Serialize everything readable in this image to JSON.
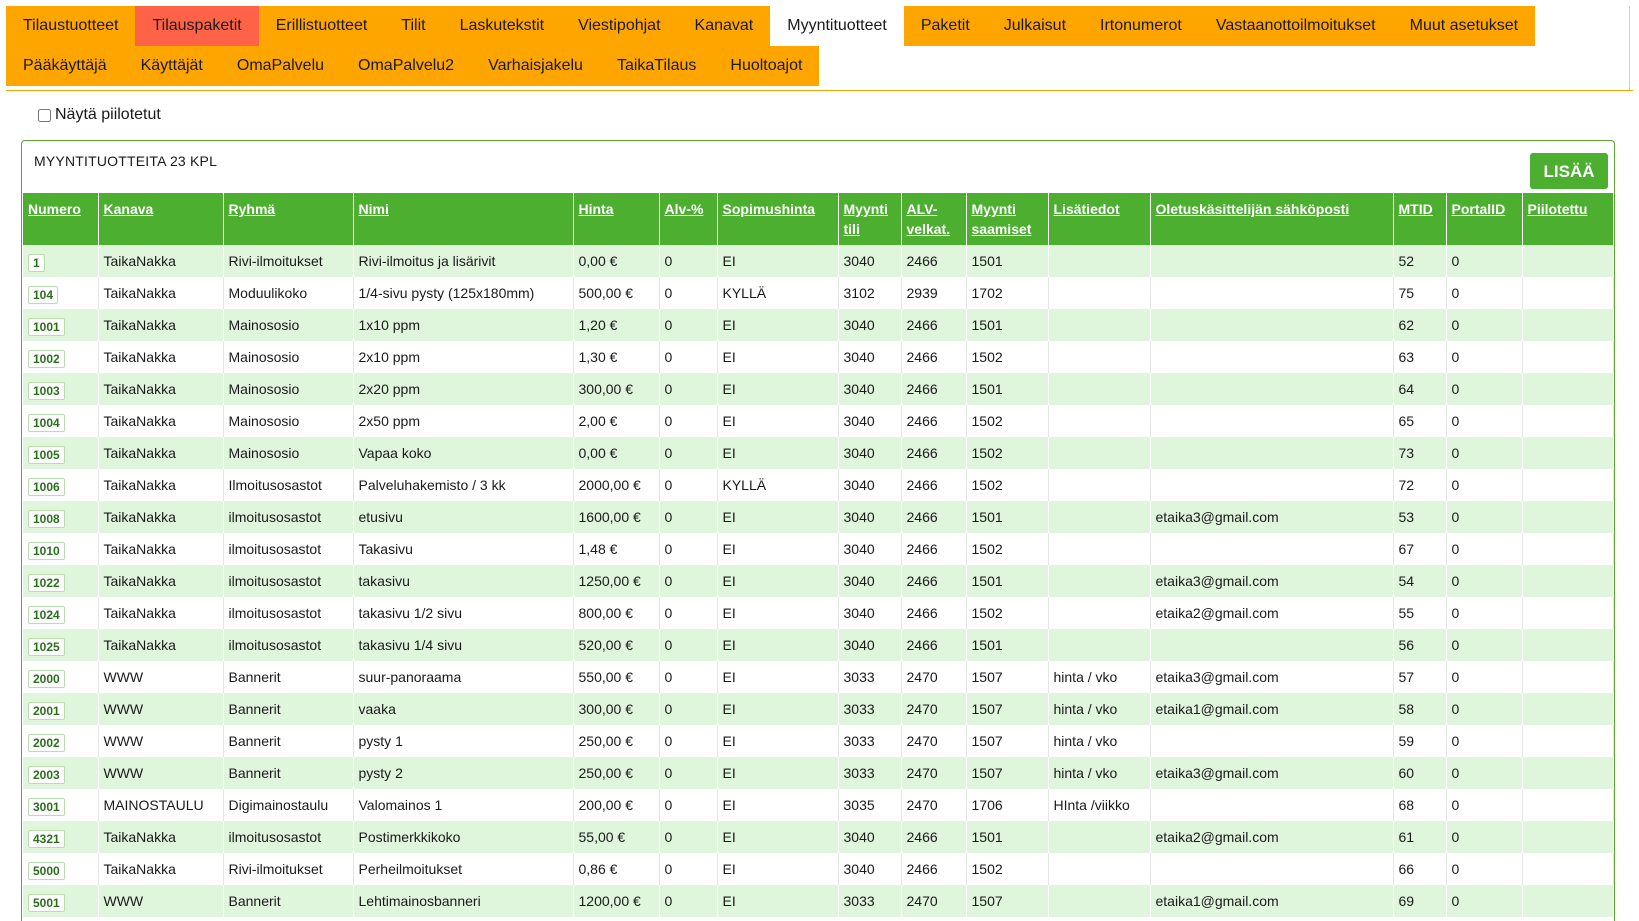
{
  "nav": {
    "row1": [
      {
        "label": "Tilaustuotteet",
        "state": "normal"
      },
      {
        "label": "Tilauspaketit",
        "state": "red"
      },
      {
        "label": "Erillistuotteet",
        "state": "normal"
      },
      {
        "label": "Tilit",
        "state": "normal"
      },
      {
        "label": "Laskutekstit",
        "state": "normal"
      },
      {
        "label": "Viestipohjat",
        "state": "normal"
      },
      {
        "label": "Kanavat",
        "state": "normal"
      },
      {
        "label": "Myyntituotteet",
        "state": "active"
      },
      {
        "label": "Paketit",
        "state": "normal"
      },
      {
        "label": "Julkaisut",
        "state": "normal"
      },
      {
        "label": "Irtonumerot",
        "state": "normal"
      },
      {
        "label": "Vastaanottoilmoitukset",
        "state": "normal"
      },
      {
        "label": "Muut asetukset",
        "state": "normal"
      }
    ],
    "row2": [
      {
        "label": "Pääkäyttäjä",
        "state": "normal"
      },
      {
        "label": "Käyttäjät",
        "state": "normal"
      },
      {
        "label": "OmaPalvelu",
        "state": "normal"
      },
      {
        "label": "OmaPalvelu2",
        "state": "normal"
      },
      {
        "label": "Varhaisjakelu",
        "state": "normal"
      },
      {
        "label": "TaikaTilaus",
        "state": "normal"
      },
      {
        "label": "Huoltoajot",
        "state": "normal"
      }
    ]
  },
  "filter": {
    "show_hidden_label": "Näytä piilotetut",
    "checked": false
  },
  "panel": {
    "title": "MYYNTITUOTTEITA 23 KPL",
    "add_label": "LISÄÄ"
  },
  "colors": {
    "accent": "#ffa500",
    "tab_red": "#ff6347",
    "header_green": "#4caf30",
    "row_green": "#dff5dc"
  },
  "table": {
    "columns": [
      {
        "key": "numero",
        "label": "Numero"
      },
      {
        "key": "kanava",
        "label": "Kanava"
      },
      {
        "key": "ryhma",
        "label": "Ryhmä"
      },
      {
        "key": "nimi",
        "label": "Nimi"
      },
      {
        "key": "hinta",
        "label": "Hinta"
      },
      {
        "key": "alv",
        "label": "Alv-%"
      },
      {
        "key": "sopimushinta",
        "label": "Sopimushinta"
      },
      {
        "key": "myyntitili",
        "label": "Myynti tili"
      },
      {
        "key": "alvvelkat",
        "label": "ALV-velkat."
      },
      {
        "key": "myyntisaamiset",
        "label": "Myynti saamiset"
      },
      {
        "key": "lisatiedot",
        "label": "Lisätiedot"
      },
      {
        "key": "email",
        "label": "Oletuskäsittelijän sähköposti"
      },
      {
        "key": "mtid",
        "label": "MTID"
      },
      {
        "key": "portalid",
        "label": "PortalID"
      },
      {
        "key": "piilotettu",
        "label": "Piilotettu"
      }
    ],
    "rows": [
      [
        "1",
        "TaikaNakka",
        "Rivi-ilmoitukset",
        "Rivi-ilmoitus ja lisärivit",
        "0,00 €",
        "0",
        "EI",
        "3040",
        "2466",
        "1501",
        "",
        "",
        "52",
        "0",
        ""
      ],
      [
        "104",
        "TaikaNakka",
        "Moduulikoko",
        "1/4-sivu pysty (125x180mm)",
        "500,00 €",
        "0",
        "KYLLÄ",
        "3102",
        "2939",
        "1702",
        "",
        "",
        "75",
        "0",
        ""
      ],
      [
        "1001",
        "TaikaNakka",
        "Mainososio",
        "1x10 ppm",
        "1,20 €",
        "0",
        "EI",
        "3040",
        "2466",
        "1501",
        "",
        "",
        "62",
        "0",
        ""
      ],
      [
        "1002",
        "TaikaNakka",
        "Mainososio",
        "2x10 ppm",
        "1,30 €",
        "0",
        "EI",
        "3040",
        "2466",
        "1502",
        "",
        "",
        "63",
        "0",
        ""
      ],
      [
        "1003",
        "TaikaNakka",
        "Mainososio",
        "2x20 ppm",
        "300,00 €",
        "0",
        "EI",
        "3040",
        "2466",
        "1501",
        "",
        "",
        "64",
        "0",
        ""
      ],
      [
        "1004",
        "TaikaNakka",
        "Mainososio",
        "2x50 ppm",
        "2,00 €",
        "0",
        "EI",
        "3040",
        "2466",
        "1502",
        "",
        "",
        "65",
        "0",
        ""
      ],
      [
        "1005",
        "TaikaNakka",
        "Mainososio",
        "Vapaa koko",
        "0,00 €",
        "0",
        "EI",
        "3040",
        "2466",
        "1502",
        "",
        "",
        "73",
        "0",
        ""
      ],
      [
        "1006",
        "TaikaNakka",
        "Ilmoitusosastot",
        "Palveluhakemisto / 3 kk",
        "2000,00 €",
        "0",
        "KYLLÄ",
        "3040",
        "2466",
        "1502",
        "",
        "",
        "72",
        "0",
        ""
      ],
      [
        "1008",
        "TaikaNakka",
        "ilmoitusosastot",
        "etusivu",
        "1600,00 €",
        "0",
        "EI",
        "3040",
        "2466",
        "1501",
        "",
        "etaika3@gmail.com",
        "53",
        "0",
        ""
      ],
      [
        "1010",
        "TaikaNakka",
        "ilmoitusosastot",
        "Takasivu",
        "1,48 €",
        "0",
        "EI",
        "3040",
        "2466",
        "1502",
        "",
        "",
        "67",
        "0",
        ""
      ],
      [
        "1022",
        "TaikaNakka",
        "ilmoitusosastot",
        "takasivu",
        "1250,00 €",
        "0",
        "EI",
        "3040",
        "2466",
        "1501",
        "",
        "etaika3@gmail.com",
        "54",
        "0",
        ""
      ],
      [
        "1024",
        "TaikaNakka",
        "ilmoitusosastot",
        "takasivu 1/2 sivu",
        "800,00 €",
        "0",
        "EI",
        "3040",
        "2466",
        "1502",
        "",
        "etaika2@gmail.com",
        "55",
        "0",
        ""
      ],
      [
        "1025",
        "TaikaNakka",
        "ilmoitusosastot",
        "takasivu 1/4 sivu",
        "520,00 €",
        "0",
        "EI",
        "3040",
        "2466",
        "1501",
        "",
        "",
        "56",
        "0",
        ""
      ],
      [
        "2000",
        "WWW",
        "Bannerit",
        "suur-panoraama",
        "550,00 €",
        "0",
        "EI",
        "3033",
        "2470",
        "1507",
        "hinta / vko",
        "etaika3@gmail.com",
        "57",
        "0",
        ""
      ],
      [
        "2001",
        "WWW",
        "Bannerit",
        "vaaka",
        "300,00 €",
        "0",
        "EI",
        "3033",
        "2470",
        "1507",
        "hinta / vko",
        "etaika1@gmail.com",
        "58",
        "0",
        ""
      ],
      [
        "2002",
        "WWW",
        "Bannerit",
        "pysty 1",
        "250,00 €",
        "0",
        "EI",
        "3033",
        "2470",
        "1507",
        "hinta / vko",
        "",
        "59",
        "0",
        ""
      ],
      [
        "2003",
        "WWW",
        "Bannerit",
        "pysty 2",
        "250,00 €",
        "0",
        "EI",
        "3033",
        "2470",
        "1507",
        "hinta / vko",
        "etaika3@gmail.com",
        "60",
        "0",
        ""
      ],
      [
        "3001",
        "MAINOSTAULU",
        "Digimainostaulu",
        "Valomainos 1",
        "200,00 €",
        "0",
        "EI",
        "3035",
        "2470",
        "1706",
        "HInta /viikko",
        "",
        "68",
        "0",
        ""
      ],
      [
        "4321",
        "TaikaNakka",
        "ilmoitusosastot",
        "Postimerkkikoko",
        "55,00 €",
        "0",
        "EI",
        "3040",
        "2466",
        "1501",
        "",
        "etaika2@gmail.com",
        "61",
        "0",
        ""
      ],
      [
        "5000",
        "TaikaNakka",
        "Rivi-ilmoitukset",
        "Perheilmoitukset",
        "0,86 €",
        "0",
        "EI",
        "3040",
        "2466",
        "1502",
        "",
        "",
        "66",
        "0",
        ""
      ],
      [
        "5001",
        "WWW",
        "Bannerit",
        "Lehtimainosbanneri",
        "1200,00 €",
        "0",
        "EI",
        "3033",
        "2470",
        "1507",
        "",
        "etaika1@gmail.com",
        "69",
        "0",
        ""
      ]
    ]
  }
}
